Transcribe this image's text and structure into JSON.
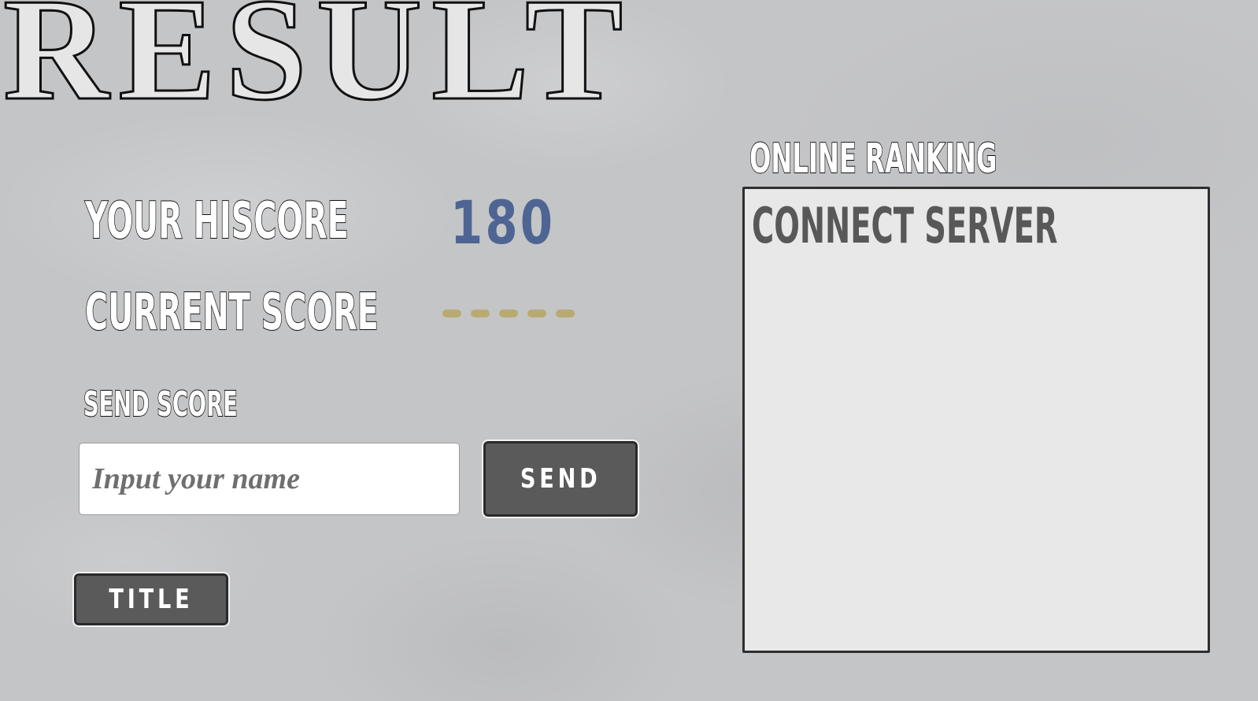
{
  "screen": {
    "title": "RESULT"
  },
  "scores": {
    "hiscore_label": "YOUR HISCORE",
    "hiscore_value": "180",
    "current_label": "CURRENT SCORE",
    "current_value_placeholder_dashes": 5
  },
  "send": {
    "label": "SEND SCORE",
    "input_value": "",
    "input_placeholder": "Input your name",
    "button_label": "SEND"
  },
  "navigation": {
    "title_button_label": "TITLE"
  },
  "ranking": {
    "header": "ONLINE RANKING",
    "status": "CONNECT SERVER"
  },
  "colors": {
    "hiscore_value": "#4e6594",
    "current_score_dashes": "#b9aa72",
    "button_bg": "#5a5a5a",
    "ranking_panel_bg": "#e8e8e8",
    "background": "#c4c5c7"
  }
}
